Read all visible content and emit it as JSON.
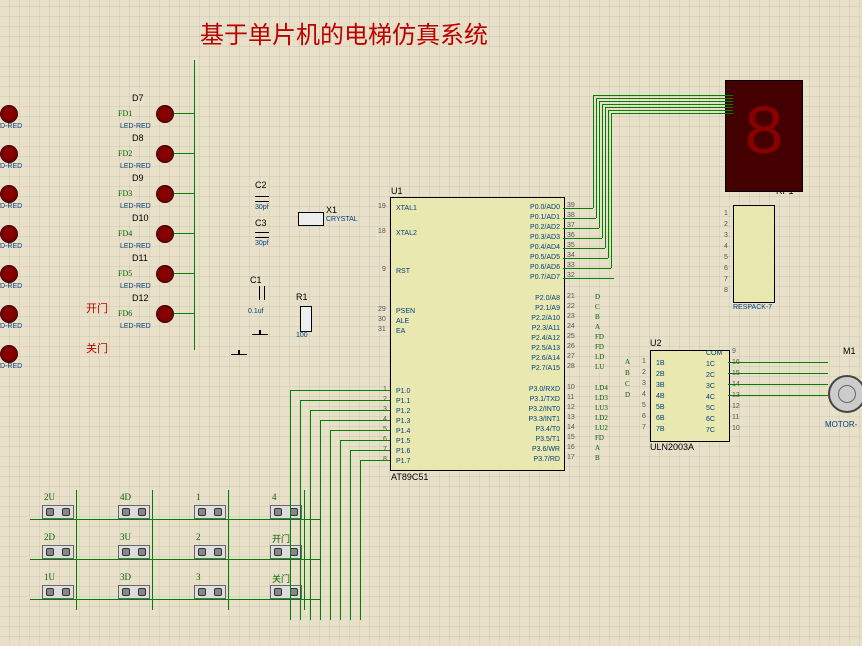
{
  "title": "基于单片机的电梯仿真系统",
  "mcu": {
    "ref": "U1",
    "part": "AT89C51",
    "left_pins": [
      {
        "num": "19",
        "name": "XTAL1"
      },
      {
        "num": "18",
        "name": "XTAL2"
      },
      {
        "num": "9",
        "name": "RST"
      },
      {
        "num": "29",
        "name": "PSEN"
      },
      {
        "num": "30",
        "name": "ALE"
      },
      {
        "num": "31",
        "name": "EA"
      },
      {
        "num": "1",
        "name": "P1.0"
      },
      {
        "num": "2",
        "name": "P1.1"
      },
      {
        "num": "3",
        "name": "P1.2"
      },
      {
        "num": "4",
        "name": "P1.3"
      },
      {
        "num": "5",
        "name": "P1.4"
      },
      {
        "num": "6",
        "name": "P1.5"
      },
      {
        "num": "7",
        "name": "P1.6"
      },
      {
        "num": "8",
        "name": "P1.7"
      }
    ],
    "right_pins": [
      {
        "num": "39",
        "name": "P0.0/AD0"
      },
      {
        "num": "38",
        "name": "P0.1/AD1"
      },
      {
        "num": "37",
        "name": "P0.2/AD2"
      },
      {
        "num": "36",
        "name": "P0.3/AD3"
      },
      {
        "num": "35",
        "name": "P0.4/AD4"
      },
      {
        "num": "34",
        "name": "P0.5/AD5"
      },
      {
        "num": "33",
        "name": "P0.6/AD6"
      },
      {
        "num": "32",
        "name": "P0.7/AD7"
      },
      {
        "num": "21",
        "name": "P2.0/A8"
      },
      {
        "num": "22",
        "name": "P2.1/A9"
      },
      {
        "num": "23",
        "name": "P2.2/A10"
      },
      {
        "num": "24",
        "name": "P2.3/A11"
      },
      {
        "num": "25",
        "name": "P2.4/A12"
      },
      {
        "num": "26",
        "name": "P2.5/A13"
      },
      {
        "num": "27",
        "name": "P2.6/A14"
      },
      {
        "num": "28",
        "name": "P2.7/A15"
      },
      {
        "num": "10",
        "name": "P3.0/RXD"
      },
      {
        "num": "11",
        "name": "P3.1/TXD"
      },
      {
        "num": "12",
        "name": "P3.2/INT0"
      },
      {
        "num": "13",
        "name": "P3.3/INT1"
      },
      {
        "num": "14",
        "name": "P3.4/T0"
      },
      {
        "num": "15",
        "name": "P3.5/T1"
      },
      {
        "num": "16",
        "name": "P3.6/WR"
      },
      {
        "num": "17",
        "name": "P3.7/RD"
      }
    ],
    "p2_nets": [
      "D",
      "C",
      "B",
      "A",
      "FD",
      "FD",
      "LD",
      "LU",
      "LD4",
      "LD3",
      "LU3",
      "LD2",
      "LU2",
      "FD",
      "A",
      "B"
    ]
  },
  "uln": {
    "ref": "U2",
    "part": "ULN2003A",
    "left_pins": [
      {
        "num": "1",
        "name": "1B"
      },
      {
        "num": "2",
        "name": "2B"
      },
      {
        "num": "3",
        "name": "3B"
      },
      {
        "num": "4",
        "name": "4B"
      },
      {
        "num": "5",
        "name": "5B"
      },
      {
        "num": "6",
        "name": "6B"
      },
      {
        "num": "7",
        "name": "7B"
      }
    ],
    "right_pins": [
      {
        "num": "9",
        "name": "COM"
      },
      {
        "num": "16",
        "name": "1C"
      },
      {
        "num": "15",
        "name": "2C"
      },
      {
        "num": "14",
        "name": "3C"
      },
      {
        "num": "13",
        "name": "4C"
      },
      {
        "num": "12",
        "name": "5C"
      },
      {
        "num": "11",
        "name": "6C"
      },
      {
        "num": "10",
        "name": "7C"
      }
    ],
    "in_nets": [
      "A",
      "B",
      "C",
      "D"
    ]
  },
  "respack": {
    "ref": "RP1",
    "part": "RESPACK-7",
    "pins": [
      "1",
      "2",
      "3",
      "4",
      "5",
      "6",
      "7",
      "8"
    ]
  },
  "motor": {
    "ref": "M1",
    "part": "MOTOR-"
  },
  "crystal": {
    "ref": "X1",
    "part": "CRYSTAL"
  },
  "caps": [
    {
      "ref": "C2",
      "val": "30pf"
    },
    {
      "ref": "C3",
      "val": "30pf"
    },
    {
      "ref": "C1",
      "val": "0.1uf"
    }
  ],
  "resistor": {
    "ref": "R1",
    "val": "100"
  },
  "leds": [
    {
      "ref": "D7",
      "net": "FD1"
    },
    {
      "ref": "D8",
      "net": "FD2"
    },
    {
      "ref": "D9",
      "net": "FD3"
    },
    {
      "ref": "D10",
      "net": "FD4"
    },
    {
      "ref": "D11",
      "net": "FD5"
    },
    {
      "ref": "D12",
      "net": "FD6"
    }
  ],
  "led_type": "LED-RED",
  "left_type": "D-RED",
  "door_labels": {
    "open": "开门",
    "close": "关门"
  },
  "buttons": {
    "col1": [
      "2U",
      "2D",
      "1U"
    ],
    "col2": [
      "4D",
      "3U",
      "3D"
    ],
    "col3": [
      "1",
      "2",
      "3"
    ],
    "col4": [
      "4",
      "开门",
      "关门"
    ]
  }
}
